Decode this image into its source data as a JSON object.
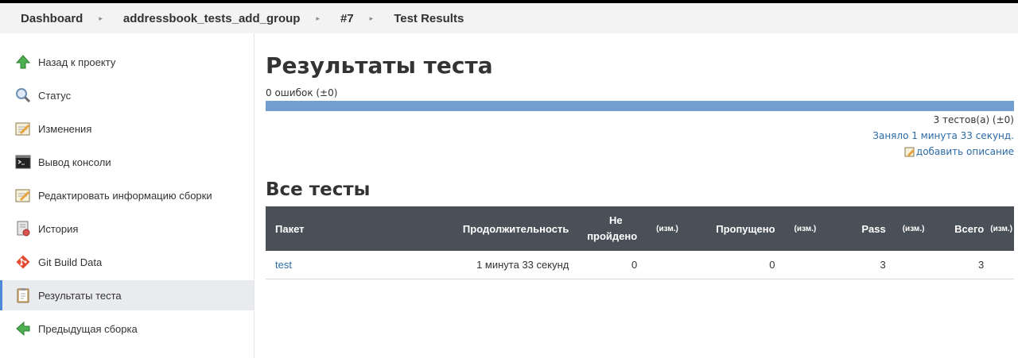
{
  "breadcrumb": [
    "Dashboard",
    "addressbook_tests_add_group",
    "#7",
    "Test Results"
  ],
  "sidebar": {
    "items": [
      {
        "label": "Назад к проекту",
        "icon": "up-arrow-icon"
      },
      {
        "label": "Статус",
        "icon": "search-icon"
      },
      {
        "label": "Изменения",
        "icon": "notepad-icon"
      },
      {
        "label": "Вывод консоли",
        "icon": "terminal-icon"
      },
      {
        "label": "Редактировать информацию сборки",
        "icon": "edit-notepad-icon"
      },
      {
        "label": "История",
        "icon": "history-icon"
      },
      {
        "label": "Git Build Data",
        "icon": "git-icon"
      },
      {
        "label": "Результаты теста",
        "icon": "clipboard-icon",
        "active": true
      },
      {
        "label": "Предыдущая сборка",
        "icon": "left-arrow-icon"
      }
    ]
  },
  "main": {
    "title": "Результаты теста",
    "fail_count": "0 ошибок (±0)",
    "tests_count": "3 тестов(а) (±0)",
    "duration": "Заняло 1 минута 33 секунд.",
    "add_description": "добавить описание",
    "section_title": "Все тесты"
  },
  "table": {
    "headers": {
      "package": "Пакет",
      "duration": "Продолжительность",
      "failed_line1": "Не",
      "failed_line2": "пройдено",
      "failed_diff": "(изм.)",
      "skipped": "Пропущено",
      "skipped_diff": "(изм.)",
      "pass": "Pass",
      "pass_diff": "(изм.)",
      "total": "Всего",
      "total_diff": "(изм.)"
    },
    "rows": [
      {
        "package": "test",
        "duration": "1 минута 33 секунд",
        "failed": "0",
        "skipped": "0",
        "pass": "3",
        "total": "3"
      }
    ]
  },
  "colors": {
    "progress_bar": "#729fcf",
    "header_bg": "#4a5057",
    "link": "#2b6aa6",
    "active_border": "#4d89d9"
  }
}
